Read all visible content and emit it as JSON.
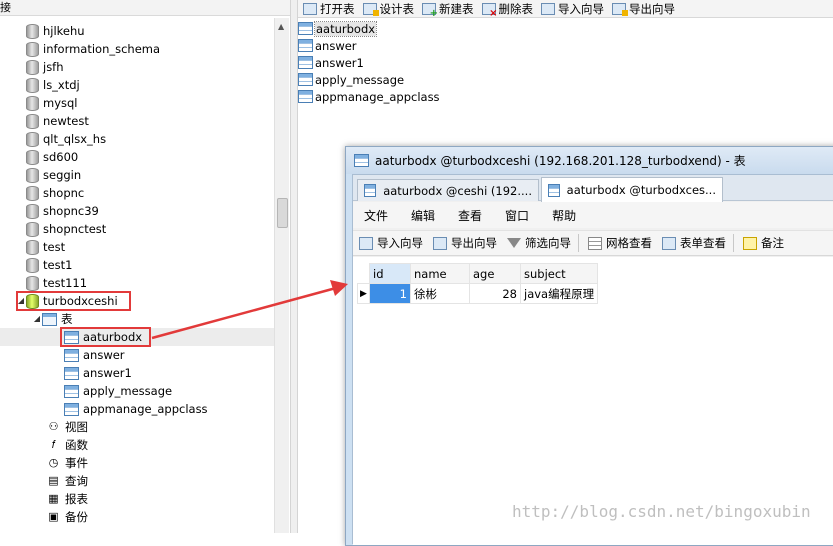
{
  "left_header": "接",
  "tree": {
    "databases": [
      "hjlkehu",
      "information_schema",
      "jsfh",
      "ls_xtdj",
      "mysql",
      "newtest",
      "qlt_qlsx_hs",
      "sd600",
      "seggin",
      "shopnc",
      "shopnc39",
      "shopnctest",
      "test",
      "test1",
      "test111"
    ],
    "active_db": "turbodxceshi",
    "tables_folder": "表",
    "tables": [
      "aaturbodx",
      "answer",
      "answer1",
      "apply_message",
      "appmanage_appclass"
    ],
    "other_nodes": [
      "视图",
      "函数",
      "事件",
      "查询",
      "报表",
      "备份"
    ]
  },
  "toolbar": {
    "open": "打开表",
    "design": "设计表",
    "new": "新建表",
    "delete": "删除表",
    "import": "导入向导",
    "export": "导出向导"
  },
  "table_list": [
    "aaturbodx",
    "answer",
    "answer1",
    "apply_message",
    "appmanage_appclass"
  ],
  "child_window": {
    "title": "aaturbodx @turbodxceshi (192.168.201.128_turbodxend) - 表",
    "tabs": [
      "aaturbodx @ceshi (192....",
      "aaturbodx @turbodxces..."
    ],
    "menu": [
      "文件",
      "编辑",
      "查看",
      "窗口",
      "帮助"
    ],
    "tools": {
      "import": "导入向导",
      "export": "导出向导",
      "filter": "筛选向导",
      "grid_view": "网格查看",
      "form_view": "表单查看",
      "note": "备注"
    },
    "grid": {
      "columns": [
        "id",
        "name",
        "age",
        "subject"
      ],
      "rows": [
        {
          "id": "1",
          "name": "徐彬",
          "age": "28",
          "subject": "java编程原理"
        }
      ]
    }
  },
  "watermark": "http://blog.csdn.net/bingoxubin",
  "colors": {
    "highlight_box": "#e23a3a",
    "selected_cell": "#3d8ee6"
  }
}
